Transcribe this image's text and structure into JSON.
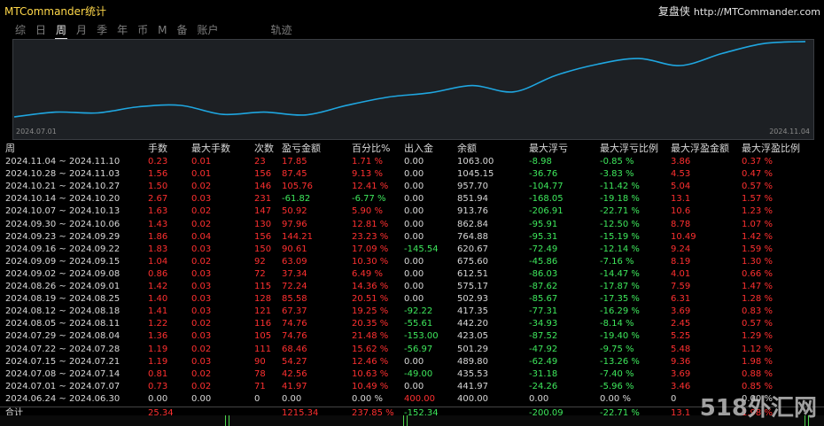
{
  "app_title": "MTCommander统计",
  "brand": {
    "name": "复盘侠",
    "url": "http://MTCommander.com"
  },
  "tabs": [
    {
      "label": "综",
      "active": false
    },
    {
      "label": "日",
      "active": false
    },
    {
      "label": "周",
      "active": true
    },
    {
      "label": "月",
      "active": false
    },
    {
      "label": "季",
      "active": false
    },
    {
      "label": "年",
      "active": false
    },
    {
      "label": "币",
      "active": false
    },
    {
      "label": "M",
      "active": false
    },
    {
      "label": "备",
      "active": false
    },
    {
      "label": "账户",
      "active": false
    },
    {
      "label": "轨迹",
      "active": false
    }
  ],
  "chart_data": {
    "type": "line",
    "x_start_label": "2024.07.01",
    "x_end_label": "2024.11.04",
    "line_color": "#1fa6e0",
    "series": [
      {
        "x": [
          "2024.06.24",
          "2024.07.01",
          "2024.07.08",
          "2024.07.15",
          "2024.07.22",
          "2024.07.29",
          "2024.08.05",
          "2024.08.12",
          "2024.08.19",
          "2024.08.26",
          "2024.09.02",
          "2024.09.09",
          "2024.09.16",
          "2024.09.23",
          "2024.09.30",
          "2024.10.07",
          "2024.10.14",
          "2024.10.21",
          "2024.10.28",
          "2024.11.04"
        ],
        "values": [
          400.0,
          441.97,
          435.53,
          489.8,
          501.29,
          423.05,
          442.2,
          417.35,
          502.93,
          575.17,
          612.51,
          675.6,
          620.67,
          764.88,
          862.84,
          913.76,
          851.94,
          957.7,
          1045.15,
          1063.0
        ]
      }
    ]
  },
  "table": {
    "headers": [
      "周",
      "手数",
      "最大手数",
      "次数",
      "盈亏金额",
      "百分比%",
      "出入金",
      "余额",
      "最大浮亏",
      "最大浮亏比例",
      "最大浮盈金额",
      "最大浮盈比例"
    ],
    "rows": [
      [
        "2024.11.04 ~ 2024.11.10",
        "0.23",
        "0.01",
        "23",
        "17.85",
        "1.71 %",
        "0.00",
        "1063.00",
        "-8.98",
        "-0.85 %",
        "3.86",
        "0.37 %"
      ],
      [
        "2024.10.28 ~ 2024.11.03",
        "1.56",
        "0.01",
        "156",
        "87.45",
        "9.13 %",
        "0.00",
        "1045.15",
        "-36.76",
        "-3.83 %",
        "4.53",
        "0.47 %"
      ],
      [
        "2024.10.21 ~ 2024.10.27",
        "1.50",
        "0.02",
        "146",
        "105.76",
        "12.41 %",
        "0.00",
        "957.70",
        "-104.77",
        "-11.42 %",
        "5.04",
        "0.57 %"
      ],
      [
        "2024.10.14 ~ 2024.10.20",
        "2.67",
        "0.03",
        "231",
        "-61.82",
        "-6.77 %",
        "0.00",
        "851.94",
        "-168.05",
        "-19.18 %",
        "13.1",
        "1.57 %"
      ],
      [
        "2024.10.07 ~ 2024.10.13",
        "1.63",
        "0.02",
        "147",
        "50.92",
        "5.90 %",
        "0.00",
        "913.76",
        "-206.91",
        "-22.71 %",
        "10.6",
        "1.23 %"
      ],
      [
        "2024.09.30 ~ 2024.10.06",
        "1.43",
        "0.02",
        "130",
        "97.96",
        "12.81 %",
        "0.00",
        "862.84",
        "-95.91",
        "-12.50 %",
        "8.78",
        "1.07 %"
      ],
      [
        "2024.09.23 ~ 2024.09.29",
        "1.86",
        "0.04",
        "156",
        "144.21",
        "23.23 %",
        "0.00",
        "764.88",
        "-95.31",
        "-15.19 %",
        "10.49",
        "1.42 %"
      ],
      [
        "2024.09.16 ~ 2024.09.22",
        "1.83",
        "0.03",
        "150",
        "90.61",
        "17.09 %",
        "-145.54",
        "620.67",
        "-72.49",
        "-12.14 %",
        "9.24",
        "1.59 %"
      ],
      [
        "2024.09.09 ~ 2024.09.15",
        "1.04",
        "0.02",
        "92",
        "63.09",
        "10.30 %",
        "0.00",
        "675.60",
        "-45.86",
        "-7.16 %",
        "8.19",
        "1.30 %"
      ],
      [
        "2024.09.02 ~ 2024.09.08",
        "0.86",
        "0.03",
        "72",
        "37.34",
        "6.49 %",
        "0.00",
        "612.51",
        "-86.03",
        "-14.47 %",
        "4.01",
        "0.66 %"
      ],
      [
        "2024.08.26 ~ 2024.09.01",
        "1.42",
        "0.03",
        "115",
        "72.24",
        "14.36 %",
        "0.00",
        "575.17",
        "-87.62",
        "-17.87 %",
        "7.59",
        "1.47 %"
      ],
      [
        "2024.08.19 ~ 2024.08.25",
        "1.40",
        "0.03",
        "128",
        "85.58",
        "20.51 %",
        "0.00",
        "502.93",
        "-85.67",
        "-17.35 %",
        "6.31",
        "1.28 %"
      ],
      [
        "2024.08.12 ~ 2024.08.18",
        "1.41",
        "0.03",
        "121",
        "67.37",
        "19.25 %",
        "-92.22",
        "417.35",
        "-77.31",
        "-16.29 %",
        "3.69",
        "0.83 %"
      ],
      [
        "2024.08.05 ~ 2024.08.11",
        "1.22",
        "0.02",
        "116",
        "74.76",
        "20.35 %",
        "-55.61",
        "442.20",
        "-34.93",
        "-8.14 %",
        "2.45",
        "0.57 %"
      ],
      [
        "2024.07.29 ~ 2024.08.04",
        "1.36",
        "0.03",
        "105",
        "74.76",
        "21.48 %",
        "-153.00",
        "423.05",
        "-87.52",
        "-19.40 %",
        "5.25",
        "1.29 %"
      ],
      [
        "2024.07.22 ~ 2024.07.28",
        "1.19",
        "0.02",
        "111",
        "68.46",
        "15.62 %",
        "-56.97",
        "501.29",
        "-47.92",
        "-9.75 %",
        "5.48",
        "1.12 %"
      ],
      [
        "2024.07.15 ~ 2024.07.21",
        "1.19",
        "0.03",
        "90",
        "54.27",
        "12.46 %",
        "0.00",
        "489.80",
        "-62.49",
        "-13.26 %",
        "9.36",
        "1.98 %"
      ],
      [
        "2024.07.08 ~ 2024.07.14",
        "0.81",
        "0.02",
        "78",
        "42.56",
        "10.63 %",
        "-49.00",
        "435.53",
        "-31.18",
        "-7.40 %",
        "3.69",
        "0.88 %"
      ],
      [
        "2024.07.01 ~ 2024.07.07",
        "0.73",
        "0.02",
        "71",
        "41.97",
        "10.49 %",
        "0.00",
        "441.97",
        "-24.26",
        "-5.96 %",
        "3.46",
        "0.85 %"
      ],
      [
        "2024.06.24 ~ 2024.06.30",
        "0.00",
        "0.00",
        "0",
        "0.00",
        "0.00 %",
        "400.00",
        "400.00",
        "0.00",
        "0.00 %",
        "0",
        "0.00 %"
      ]
    ],
    "total": [
      "合计",
      "25.34",
      "",
      "",
      "1215.34",
      "237.85 %",
      "-152.34",
      "",
      "-200.09",
      "-22.71 %",
      "13.1",
      "1.98 %"
    ]
  },
  "watermark": "518外汇网"
}
